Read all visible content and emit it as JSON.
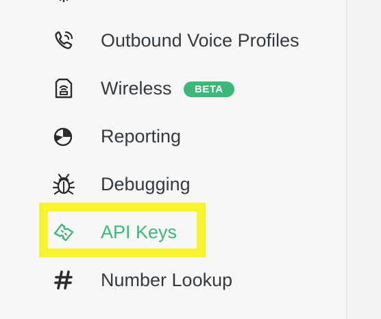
{
  "sidebar": {
    "items": [
      {
        "label": "Outbound Voice Profiles",
        "icon": "phone-ringing-icon"
      },
      {
        "label": "Wireless",
        "icon": "sim-card-icon",
        "badge": "BETA"
      },
      {
        "label": "Reporting",
        "icon": "pie-chart-icon"
      },
      {
        "label": "Debugging",
        "icon": "bug-icon"
      },
      {
        "label": "API Keys",
        "icon": "key-ticket-icon",
        "active": true
      },
      {
        "label": "Number Lookup",
        "icon": "hashtag-icon"
      }
    ]
  },
  "colors": {
    "accent": "#3cb879",
    "text": "#333a40",
    "highlight": "#f7f42e",
    "background": "#f7f7f7"
  }
}
